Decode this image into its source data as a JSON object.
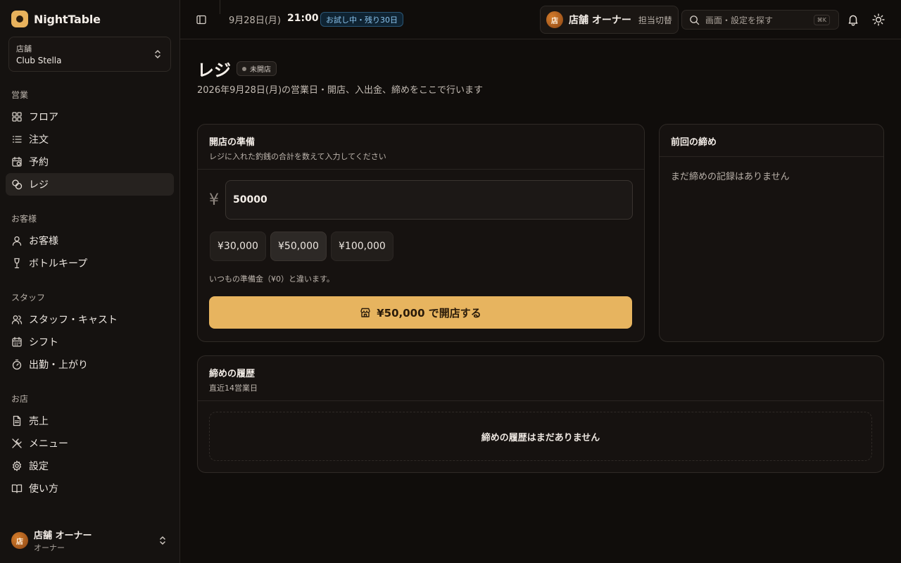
{
  "brand": {
    "name": "NightTable"
  },
  "store": {
    "label": "店舗",
    "name": "Club Stella"
  },
  "nav": [
    {
      "title": "営業",
      "items": [
        {
          "label": "フロア",
          "icon": "grid-icon"
        },
        {
          "label": "注文",
          "icon": "list-icon"
        },
        {
          "label": "予約",
          "icon": "calendar-clock-icon"
        },
        {
          "label": "レジ",
          "icon": "coins-icon",
          "active": true
        }
      ]
    },
    {
      "title": "お客様",
      "items": [
        {
          "label": "お客様",
          "icon": "user-icon"
        },
        {
          "label": "ボトルキープ",
          "icon": "wine-icon"
        }
      ]
    },
    {
      "title": "スタッフ",
      "items": [
        {
          "label": "スタッフ・キャスト",
          "icon": "users-icon"
        },
        {
          "label": "シフト",
          "icon": "calendar-icon"
        },
        {
          "label": "出勤・上がり",
          "icon": "timer-icon"
        }
      ]
    },
    {
      "title": "お店",
      "items": [
        {
          "label": "売上",
          "icon": "document-icon"
        },
        {
          "label": "メニュー",
          "icon": "utensils-icon"
        },
        {
          "label": "設定",
          "icon": "gear-icon"
        },
        {
          "label": "使い方",
          "icon": "book-icon"
        }
      ]
    }
  ],
  "user": {
    "avatar": "店",
    "name": "店舗 オーナー",
    "role": "オーナー"
  },
  "header": {
    "date": "9月28日(月)",
    "time": "21:00",
    "trial": "お試し中・残り30日",
    "staff_avatar": "店",
    "staff_name": "店舗 オーナー",
    "switch_label": "担当切替",
    "search_placeholder": "画面・設定を探す",
    "shortcut": "⌘K"
  },
  "page": {
    "title": "レジ",
    "status": "未開店",
    "subtitle": "2026年9月28日(月)の営業日・開店、入出金、締めをここで行います"
  },
  "opening": {
    "title": "開店の準備",
    "desc": "レジに入れた釣銭の合計を数えて入力してください",
    "currency": "¥",
    "amount": "50000",
    "presets": [
      "¥30,000",
      "¥50,000",
      "¥100,000"
    ],
    "hint": "いつもの準備金（¥0）と違います。",
    "button": "¥50,000 で開店する"
  },
  "last_close": {
    "title": "前回の締め",
    "empty": "まだ締めの記録はありません"
  },
  "history": {
    "title": "締めの履歴",
    "desc": "直近14営業日",
    "empty": "締めの履歴はまだありません"
  },
  "colors": {
    "accent": "#e7b45f",
    "background": "#100d0b",
    "trial": "#8bc4ee"
  }
}
